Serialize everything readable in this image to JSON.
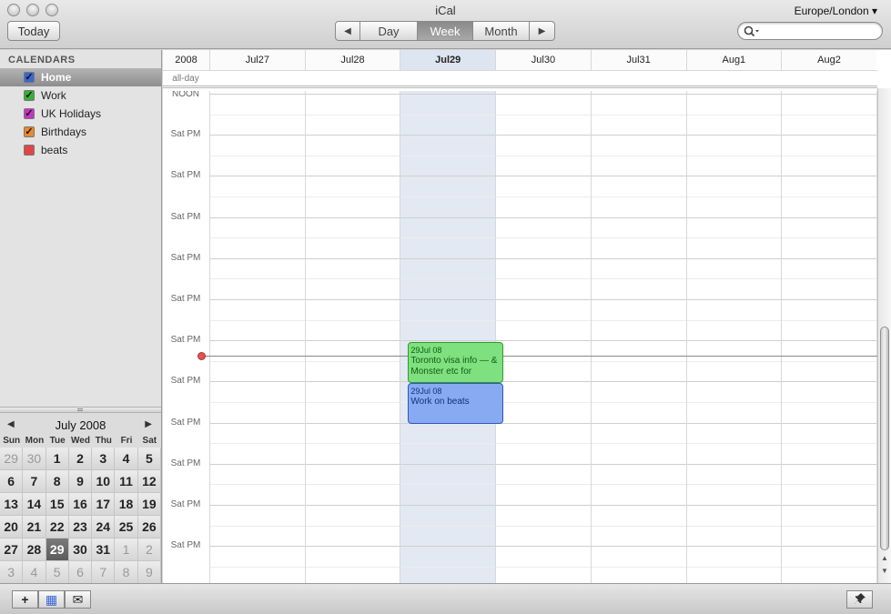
{
  "window": {
    "title": "iCal",
    "timezone": "Europe/London ▾"
  },
  "toolbar": {
    "today_label": "Today",
    "prev_label": "◀",
    "next_label": "▶",
    "views": [
      "Day",
      "Week",
      "Month"
    ],
    "active_view": "Week",
    "search_placeholder": ""
  },
  "sidebar": {
    "header": "CALENDARS",
    "calendars": [
      {
        "label": "Home",
        "color": "#3a66d4",
        "checked": true,
        "selected": true
      },
      {
        "label": "Work",
        "color": "#35b135",
        "checked": true,
        "selected": false
      },
      {
        "label": "UK Holidays",
        "color": "#c732c7",
        "checked": true,
        "selected": false
      },
      {
        "label": "Birthdays",
        "color": "#e98a2c",
        "checked": true,
        "selected": false
      },
      {
        "label": "beats",
        "color": "#e24545",
        "checked": false,
        "selected": false
      }
    ]
  },
  "mini_calendar": {
    "title": "July 2008",
    "prev": "◀",
    "next": "▶",
    "dows": [
      "Sun",
      "Mon",
      "Tue",
      "Wed",
      "Thu",
      "Fri",
      "Sat"
    ],
    "days": [
      {
        "d": "29",
        "out": true
      },
      {
        "d": "30",
        "out": true
      },
      {
        "d": "1"
      },
      {
        "d": "2"
      },
      {
        "d": "3"
      },
      {
        "d": "4"
      },
      {
        "d": "5"
      },
      {
        "d": "6"
      },
      {
        "d": "7"
      },
      {
        "d": "8"
      },
      {
        "d": "9"
      },
      {
        "d": "10"
      },
      {
        "d": "11"
      },
      {
        "d": "12"
      },
      {
        "d": "13"
      },
      {
        "d": "14"
      },
      {
        "d": "15"
      },
      {
        "d": "16"
      },
      {
        "d": "17"
      },
      {
        "d": "18"
      },
      {
        "d": "19"
      },
      {
        "d": "20"
      },
      {
        "d": "21"
      },
      {
        "d": "22"
      },
      {
        "d": "23"
      },
      {
        "d": "24"
      },
      {
        "d": "25"
      },
      {
        "d": "26"
      },
      {
        "d": "27"
      },
      {
        "d": "28"
      },
      {
        "d": "29",
        "today": true
      },
      {
        "d": "30"
      },
      {
        "d": "31"
      },
      {
        "d": "1",
        "out": true
      },
      {
        "d": "2",
        "out": true
      },
      {
        "d": "3",
        "out": true
      },
      {
        "d": "4",
        "out": true
      },
      {
        "d": "5",
        "out": true
      },
      {
        "d": "6",
        "out": true
      },
      {
        "d": "7",
        "out": true
      },
      {
        "d": "8",
        "out": true
      },
      {
        "d": "9",
        "out": true
      }
    ]
  },
  "week": {
    "year_label": "2008",
    "allday_label": "all-day",
    "days": [
      "Jul27",
      "Jul28",
      "Jul29",
      "Jul30",
      "Jul31",
      "Aug1",
      "Aug2"
    ],
    "today_index": 2,
    "time_labels": [
      "NOON",
      "Sat PM",
      "Sat PM",
      "Sat PM",
      "Sat PM",
      "Sat PM",
      "Sat PM",
      "Sat PM",
      "Sat PM",
      "Sat PM",
      "Sat PM",
      "Sat PM"
    ]
  },
  "events": [
    {
      "date": "29Jul 08",
      "title": "Toronto visa info — & Monster etc for",
      "style": "green"
    },
    {
      "date": "29Jul 08",
      "title": "Work on beats",
      "style": "blue"
    }
  ],
  "bottombar": {
    "add": "+",
    "calendar_icon": "▦",
    "mail_icon": "✉",
    "pin_icon": "📌"
  }
}
